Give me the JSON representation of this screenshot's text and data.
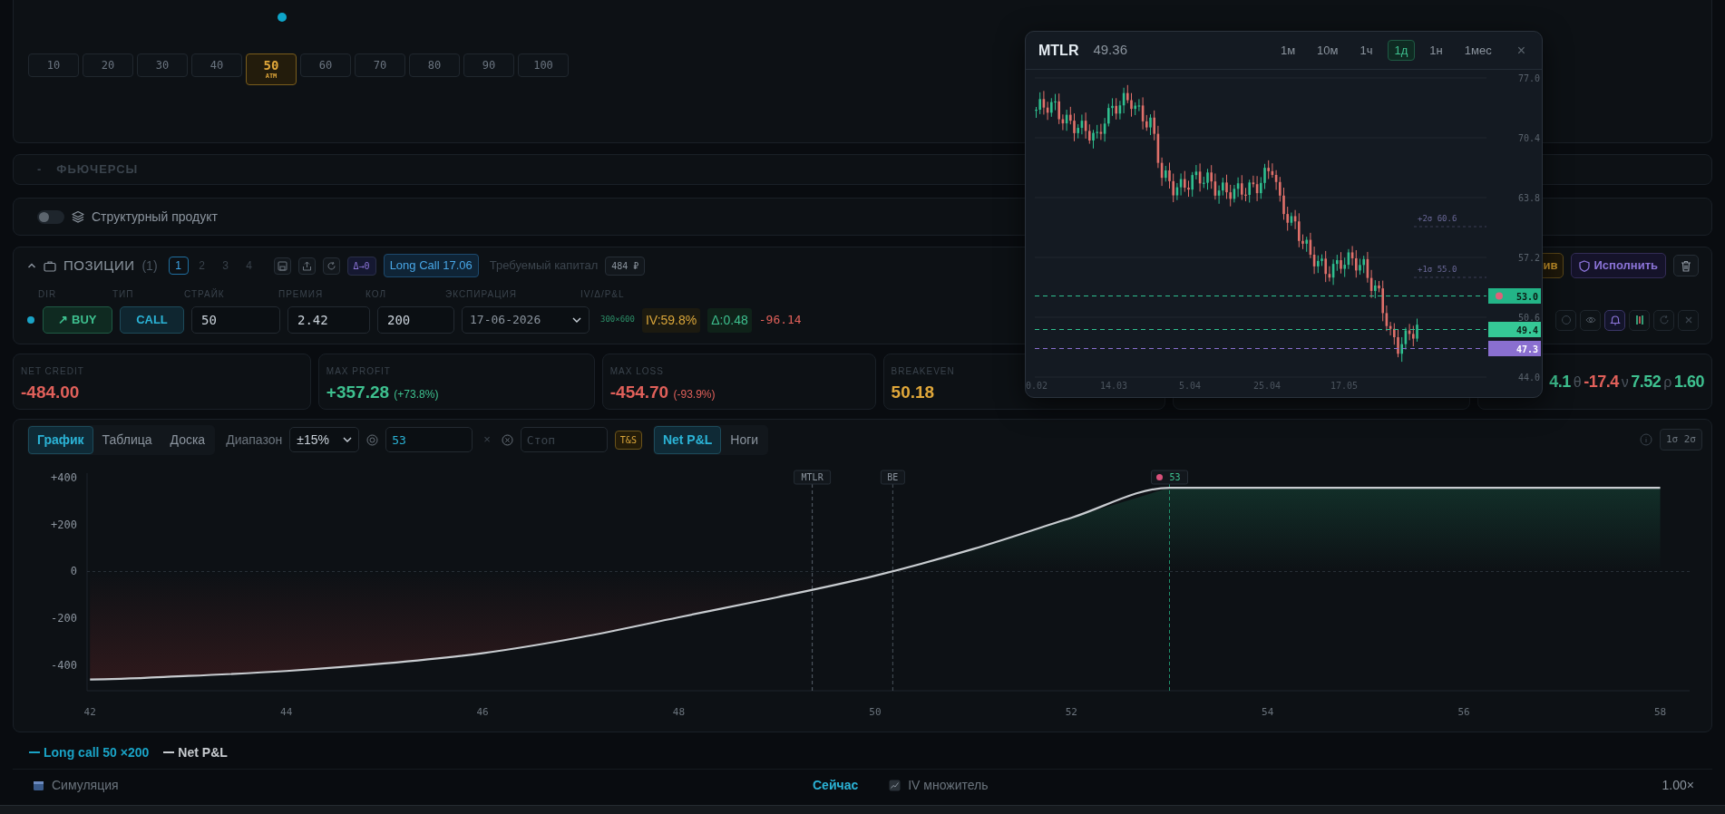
{
  "strike_picker": {
    "strikes": [
      {
        "label": "10",
        "selected": false
      },
      {
        "label": "20",
        "selected": false
      },
      {
        "label": "30",
        "selected": false
      },
      {
        "label": "40",
        "selected": false
      },
      {
        "label": "50",
        "selected": true,
        "tag": "ATM"
      },
      {
        "label": "60",
        "selected": false
      },
      {
        "label": "70",
        "selected": false
      },
      {
        "label": "80",
        "selected": false
      },
      {
        "label": "90",
        "selected": false
      },
      {
        "label": "100",
        "selected": false
      }
    ]
  },
  "futures": {
    "toggle": "-",
    "title": "ФЬЮЧЕРСЫ"
  },
  "structured_product": {
    "label": "Структурный продукт",
    "on": false
  },
  "positions": {
    "title": "ПОЗИЦИИ",
    "count": "(1)",
    "pages": [
      {
        "label": "1",
        "selected": true
      },
      {
        "label": "2",
        "selected": false
      },
      {
        "label": "3",
        "selected": false
      },
      {
        "label": "4",
        "selected": false
      }
    ],
    "delta_badge": "Δ→0",
    "strategy": "Long Call 17.06",
    "capital_label": "Требуемый капитал",
    "capital": "484 ₽",
    "partial_button": "ив",
    "execute_button": "Исполнить",
    "columns": [
      "DIR",
      "ТИП",
      "СТРАЙК",
      "ПРЕМИЯ",
      "КОЛ",
      "ЭКСПИРАЦИЯ",
      "IV/Δ/P&L"
    ],
    "rows": [
      {
        "side": "↗ BUY",
        "type": "CALL",
        "strike": "50",
        "premium": "2.42",
        "qty": "200",
        "expiry": "17-06-2026",
        "size": "300×600",
        "iv": "IV:59.8%",
        "delta": "Δ:0.48",
        "pnl": "-96.14"
      }
    ],
    "row_actions": [
      {
        "kind": "circle",
        "active": false
      },
      {
        "kind": "eye",
        "active": false
      },
      {
        "kind": "bell",
        "active": true
      },
      {
        "kind": "candles",
        "active": false
      },
      {
        "kind": "refresh",
        "active": false
      },
      {
        "kind": "close",
        "active": false
      }
    ]
  },
  "metrics": [
    {
      "label": "NET CREDIT",
      "value": "-484.00",
      "color": "#e0605a"
    },
    {
      "label": "MAX PROFIT",
      "value": "+357.28",
      "note": "(+73.8%)",
      "color": "#3ec08f"
    },
    {
      "label": "MAX LOSS",
      "value": "-454.70",
      "note": "(-93.9%)",
      "color": "#e0605a"
    },
    {
      "label": "BREAKEVEN",
      "value": "50.18",
      "color": "#e0a73a"
    }
  ],
  "greeks": [
    {
      "value": "4.1",
      "color": "#3ec08f"
    },
    {
      "symbol": "θ",
      "value": "-17.4",
      "color": "#e0605a"
    },
    {
      "symbol": "ν",
      "value": "7.52",
      "color": "#3ec08f"
    },
    {
      "symbol": "ρ",
      "value": "1.60",
      "color": "#3ec08f"
    }
  ],
  "pnl_panel": {
    "views": [
      {
        "label": "График",
        "selected": true
      },
      {
        "label": "Таблица",
        "selected": false
      },
      {
        "label": "Доска",
        "selected": false
      }
    ],
    "range_label": "Диапазон",
    "range": "±15%",
    "target": "53",
    "clear": "×",
    "stop_placeholder": "Стоп",
    "ts_badge": "T&S",
    "modes": [
      {
        "label": "Net P&L",
        "selected": true
      },
      {
        "label": "Ноги",
        "selected": false
      }
    ],
    "sigma_button": "1σ 2σ",
    "chart_data": {
      "type": "line",
      "x": [
        42,
        43,
        44,
        45,
        46,
        47,
        48,
        49,
        50,
        51,
        52,
        53,
        54,
        55,
        56,
        57,
        58
      ],
      "series": [
        {
          "name": "Net P&L",
          "color": "#c8ccd0",
          "values": [
            -460,
            -445,
            -424,
            -392,
            -348,
            -280,
            -195,
            -110,
            -18,
            96,
            229,
            357,
            357,
            357,
            357,
            357,
            357
          ]
        }
      ],
      "xlim": [
        41.97,
        58.3
      ],
      "ylim": [
        -508,
        419
      ],
      "xticks": [
        42,
        44,
        46,
        48,
        50,
        52,
        54,
        56,
        58
      ],
      "yticks": [
        {
          "value": 400,
          "label": "+400"
        },
        {
          "value": 200,
          "label": "+200"
        },
        0,
        -200,
        -400
      ],
      "ref_lines": [
        {
          "axis": "x",
          "value": 49.36,
          "label": "MTLR",
          "color": "#59626c"
        },
        {
          "axis": "x",
          "value": 50.18,
          "label": "BE",
          "color": "#4a535c"
        },
        {
          "axis": "x",
          "value": 53,
          "label": "53",
          "color": "#1f8f6a"
        }
      ]
    },
    "legend": [
      {
        "label": "Long call 50 ×200",
        "color": "#1aa3c6"
      }
    ]
  },
  "simulation": {
    "label": "Симуляция",
    "mode": "Сейчас",
    "iv_label": "IV множитель",
    "iv_value": "1.00×"
  },
  "price_popup": {
    "ticker": "MTLR",
    "price": "49.36",
    "timeframes": [
      {
        "label": "1м",
        "selected": false
      },
      {
        "label": "10м",
        "selected": false
      },
      {
        "label": "1ч",
        "selected": false
      },
      {
        "label": "1д",
        "selected": true
      },
      {
        "label": "1н",
        "selected": false
      },
      {
        "label": "1мес",
        "selected": false
      }
    ],
    "close": "×",
    "y_labels": [
      "77.0",
      "70.4",
      "63.8",
      "57.2",
      "50.6",
      "44.0"
    ],
    "x_labels": [
      "0.02",
      "14.03",
      "5.04",
      "25.04",
      "17.05"
    ],
    "bands": [
      {
        "label": "+2σ 60.6"
      },
      {
        "label": "+1σ 55.0"
      }
    ],
    "levels": [
      {
        "label": "53.0",
        "kind": "target"
      },
      {
        "label": "49.4",
        "kind": "last"
      },
      {
        "label": "47.3",
        "kind": "support"
      }
    ]
  }
}
